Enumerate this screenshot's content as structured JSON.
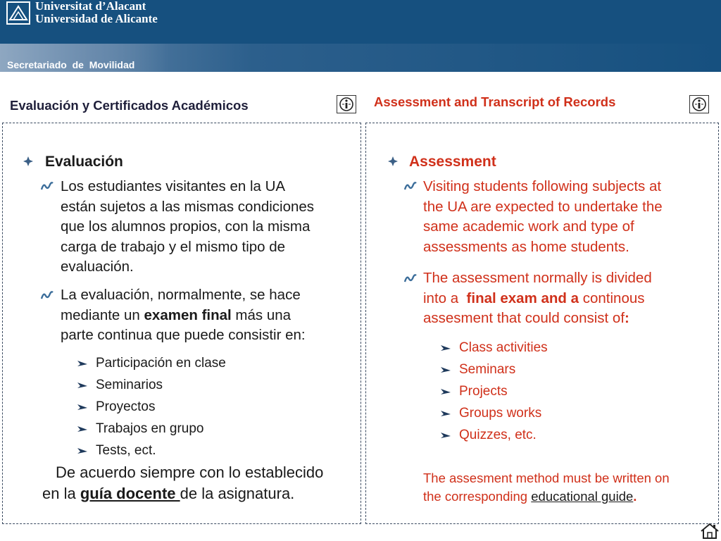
{
  "header": {
    "university_line1": "Universitat d’Alacant",
    "university_line2": "Universidad de Alicante",
    "department": "Secretariado  de  Movilidad",
    "bg_color": "#16507f"
  },
  "spanish": {
    "section_title": "Evaluación y Certificados Académicos",
    "heading": "Evaluación",
    "para1_lines": [
      "Los estudiantes visitantes en la UA",
      "están sujetos a las mismas condiciones",
      "que los alumnos propios, con la misma",
      "carga de trabajo y el mismo tipo de",
      "evaluación."
    ],
    "para2_line1": "La evaluación, normalmente, se hace",
    "para2_line2_pre": "mediante un ",
    "para2_line2_bold": "examen final",
    "para2_line2_post": " más una",
    "para2_line3": "parte continua que puede consistir en:",
    "items": [
      "Participación en clase",
      "Seminarios",
      "Proyectos",
      "Trabajos en grupo",
      "Tests, ect."
    ],
    "footer_line1": "De acuerdo siempre con lo establecido",
    "footer_pre": "en la ",
    "footer_link": "guía docente ",
    "footer_post": "de la asignatura."
  },
  "english": {
    "section_title": "Assessment and Transcript of Records",
    "heading": "Assessment",
    "para1_lines": [
      "Visiting students following subjects at",
      "the UA are expected to undertake the",
      "same academic work and type of",
      "assessments as home students."
    ],
    "para2_line1": "The assessment normally is divided",
    "para2_line2_pre": "into a  ",
    "para2_line2_bold": "final exam and a",
    "para2_line2_post": " continous",
    "para2_line3_pre": "assesment that could consist of",
    "para2_line3_bold": ":",
    "items": [
      "Class activities",
      "Seminars",
      "Projects",
      "Groups works",
      "Quizzes, etc."
    ],
    "footer_line1": "The assesment method must be written on",
    "footer_pre": "the corresponding ",
    "footer_link": "educational guide",
    "footer_post": ".",
    "accent_color": "#d0301a"
  },
  "icons": {
    "info": "info-icon",
    "home": "home-icon"
  }
}
